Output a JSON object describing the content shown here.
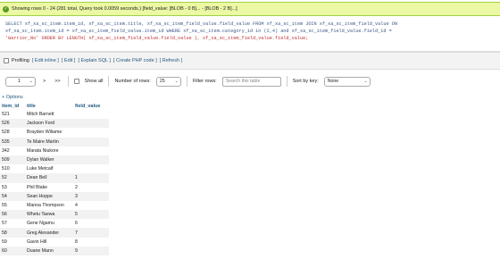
{
  "status": {
    "message": "Showing rows 0 - 24 (281 total, Query took 0.0059 seconds.) [field_value: [BLOB - 0 B]... - [BLOB - 2 B]...]"
  },
  "sql": {
    "line1": "SELECT xf_xa_sc_item.item_id, xf_xa_sc_item.title, xf_xa_sc_item_field_value.field_value FROM xf_xa_sc_item JOIN xf_xa_sc_item_field_value ON",
    "line2": "xf_xa_sc_item.item_id = xf_xa_sc_item_field_value.item_id WHERE xf_xa_sc_item.category_id in (2,4) and xf_xa_sc_item_field_value.field_id =",
    "line3": "'Warrior_No' ORDER BY LENGTH( xf_xa_sc_item_field_value.field_value ), xf_xa_sc_item_field_value.field_value;"
  },
  "profiling": {
    "label": "Profiling",
    "edit_inline": "[ Edit inline ]",
    "edit": "[ Edit ]",
    "explain": "[ Explain SQL ]",
    "php": "[ Create PHP code ]",
    "refresh": "[ Refresh ]"
  },
  "nav": {
    "page_select": "1",
    "next": ">",
    "last": ">>",
    "show_all": "Show all",
    "rows_label": "Number of rows:",
    "rows_value": "25",
    "filter_label": "Filter rows:",
    "filter_placeholder": "Search this table",
    "sort_label": "Sort by key:",
    "sort_value": "None"
  },
  "options_link": "+ Options",
  "table": {
    "columns": [
      "item_id",
      "title",
      "field_value"
    ],
    "rows": [
      [
        "521",
        "Mitch Barnett",
        ""
      ],
      [
        "526",
        "Jackson Ford",
        ""
      ],
      [
        "528",
        "Brayden Wiliame",
        ""
      ],
      [
        "535",
        "Te Maire Martin",
        ""
      ],
      [
        "342",
        "Marata Niukore",
        ""
      ],
      [
        "509",
        "Dylan Walker",
        ""
      ],
      [
        "510",
        "Luke Metcalf",
        ""
      ],
      [
        "52",
        "Dean Bell",
        "1"
      ],
      [
        "53",
        "Phil Blake",
        "2"
      ],
      [
        "54",
        "Sean Hoppe",
        "3"
      ],
      [
        "55",
        "Manoa Thompson",
        "4"
      ],
      [
        "56",
        "Whetu Taewa",
        "5"
      ],
      [
        "57",
        "Gene Ngamu",
        "6"
      ],
      [
        "58",
        "Greg Alexander",
        "7"
      ],
      [
        "59",
        "Gavin Hill",
        "8"
      ],
      [
        "60",
        "Duane Mann",
        "9"
      ]
    ]
  }
}
